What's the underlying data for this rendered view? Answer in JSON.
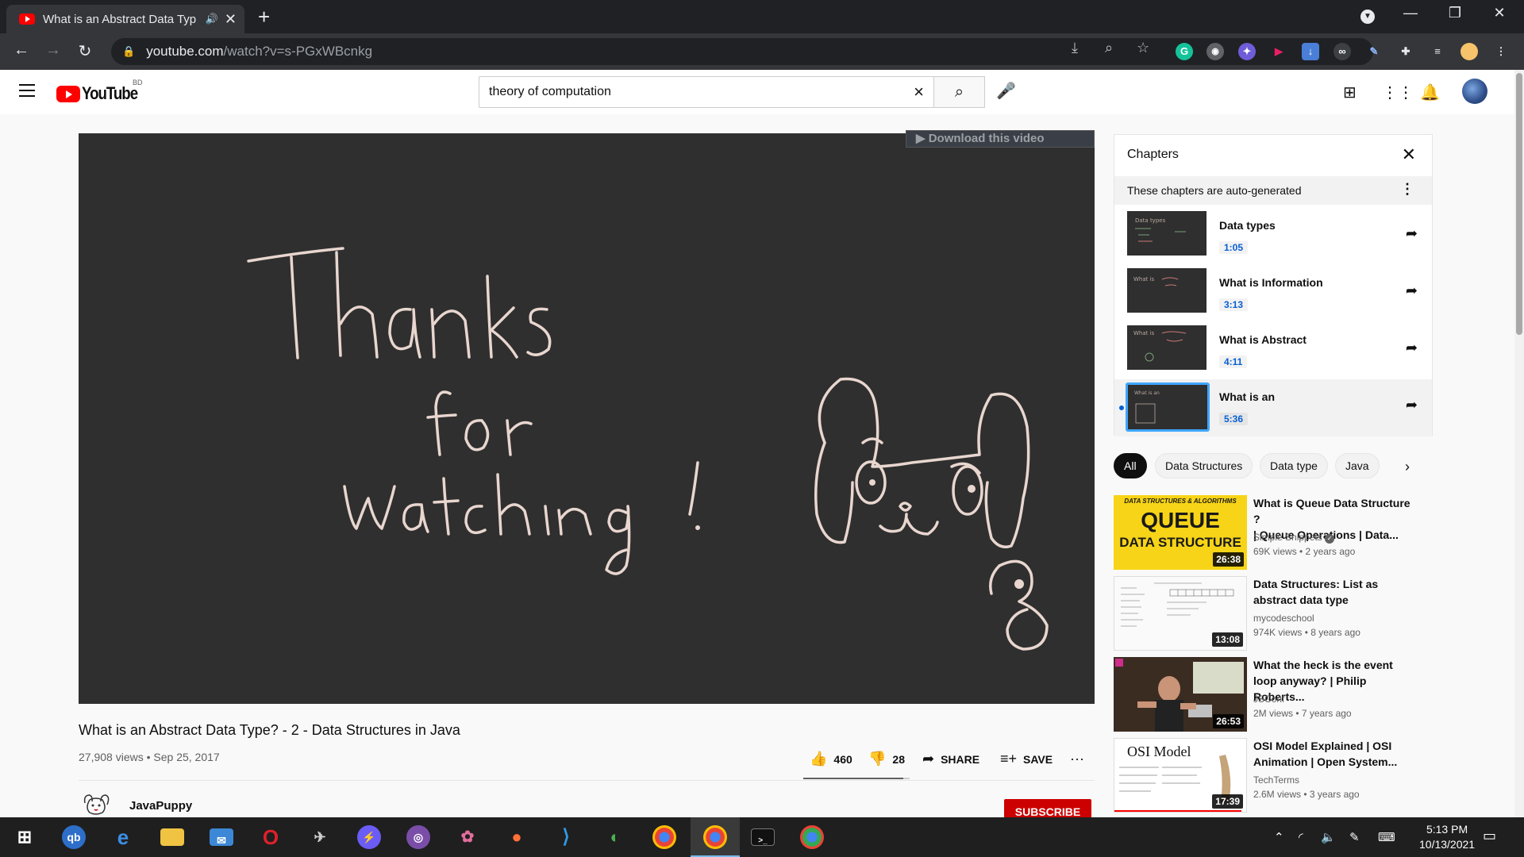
{
  "browser": {
    "tab_title": "What is an Abstract Data Typ",
    "url_host": "youtube.com",
    "url_path": "/watch?v=s-PGxWBcnkg",
    "window_buttons": [
      "—",
      "❐",
      "✕"
    ]
  },
  "masthead": {
    "logo_text": "YouTube",
    "country_code": "BD",
    "search_value": "theory of computation"
  },
  "player": {
    "download_banner": "▶ Download this video"
  },
  "video": {
    "title": "What is an Abstract Data Type? - 2 - Data Structures in Java",
    "views_date": "27,908 views • Sep 25, 2017",
    "like_count": "460",
    "dislike_count": "28",
    "like_ratio": 0.94,
    "share_label": "SHARE",
    "save_label": "SAVE",
    "channel": "JavaPuppy",
    "subscribe_label": "SUBSCRIBE"
  },
  "chapters": {
    "heading": "Chapters",
    "subheading": "These chapters are auto-generated",
    "items": [
      {
        "title": "Data types",
        "time": "1:05"
      },
      {
        "title": "What is Information",
        "time": "3:13"
      },
      {
        "title": "What is Abstract",
        "time": "4:11"
      },
      {
        "title": "What is an",
        "time": "5:36"
      }
    ]
  },
  "chips": [
    "All",
    "Data Structures",
    "Data type",
    "Java"
  ],
  "related": [
    {
      "title_line1": "What is Queue Data Structure ?",
      "title_line2": "| Queue Operations | Data...",
      "channel": "Simple Snippets",
      "meta": "69K views • 2 years ago",
      "duration": "26:38",
      "thumb_line1": "DATA STRUCTURES & ALGORITHMS",
      "thumb_line2": "QUEUE",
      "thumb_line3": "DATA STRUCTURE"
    },
    {
      "title_line1": "Data Structures: List as",
      "title_line2": "abstract data type",
      "channel": "mycodeschool",
      "meta": "974K views • 8 years ago",
      "duration": "13:08"
    },
    {
      "title_line1": "What the heck is the event",
      "title_line2": "loop anyway? | Philip Roberts...",
      "channel": "JSConf",
      "meta": "2M views • 7 years ago",
      "duration": "26:53"
    },
    {
      "title_line1": "OSI Model Explained | OSI",
      "title_line2": "Animation | Open System...",
      "channel": "TechTerms",
      "meta": "2.6M views • 3 years ago",
      "duration": "17:39",
      "thumb_title": "OSI Model"
    }
  ],
  "taskbar": {
    "time": "5:13 PM",
    "date": "10/13/2021"
  },
  "colors": {
    "brand_red": "#ff0000",
    "subscribe_red": "#cc0000",
    "link_blue": "#065fd4",
    "player_bg": "#2f2f2f"
  }
}
